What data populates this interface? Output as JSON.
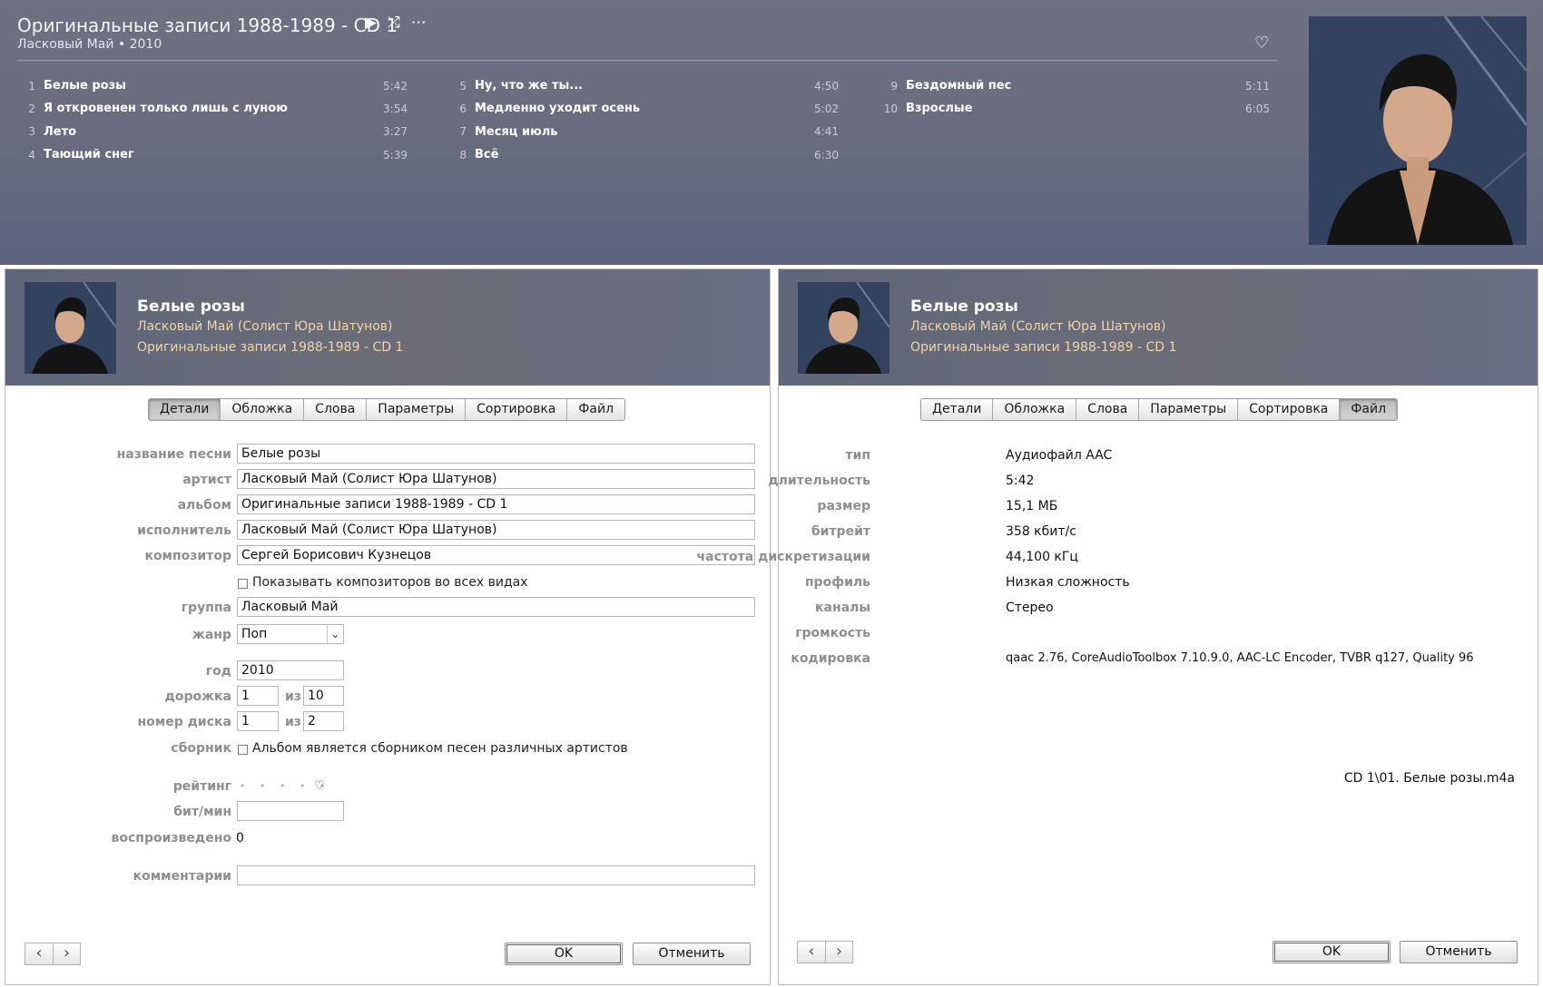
{
  "album": {
    "title": "Оригинальные записи 1988-1989 - CD 1",
    "subtitle": "Ласковый Май • 2010",
    "controls": {
      "play": "▶",
      "shuffle": "⤮",
      "more": "⋯"
    },
    "heart": "♡",
    "columns": [
      [
        {
          "num": "1",
          "name": "Белые розы",
          "dur": "5:42"
        },
        {
          "num": "2",
          "name": "Я откровенен только лишь с луною",
          "dur": "3:54"
        },
        {
          "num": "3",
          "name": "Лето",
          "dur": "3:27"
        },
        {
          "num": "4",
          "name": "Тающий снег",
          "dur": "5:39"
        }
      ],
      [
        {
          "num": "5",
          "name": "Ну, что же ты...",
          "dur": "4:50"
        },
        {
          "num": "6",
          "name": "Медленно уходит осень",
          "dur": "5:02"
        },
        {
          "num": "7",
          "name": "Месяц июль",
          "dur": "4:41"
        },
        {
          "num": "8",
          "name": "Всё",
          "dur": "6:30"
        }
      ],
      [
        {
          "num": "9",
          "name": "Бездомный пес",
          "dur": "5:11"
        },
        {
          "num": "10",
          "name": "Взрослые",
          "dur": "6:05"
        }
      ]
    ]
  },
  "song": {
    "title": "Белые розы",
    "artist": "Ласковый Май (Солист Юра Шатунов)",
    "album": "Оригинальные записи 1988-1989 - CD 1"
  },
  "tabs": [
    "Детали",
    "Обложка",
    "Слова",
    "Параметры",
    "Сортировка",
    "Файл"
  ],
  "details": {
    "labels": {
      "name": "название песни",
      "artist": "артист",
      "album": "альбом",
      "album_artist": "исполнитель",
      "composer": "композитор",
      "grouping": "группа",
      "genre": "жанр",
      "year": "год",
      "track": "дорожка",
      "disc": "номер диска",
      "compilation": "сборник",
      "rating": "рейтинг",
      "bpm": "бит/мин",
      "plays": "воспроизведено",
      "comments": "комментарии",
      "of": "из"
    },
    "values": {
      "name": "Белые розы",
      "artist": "Ласковый Май (Солист Юра Шатунов)",
      "album": "Оригинальные записи 1988-1989 - CD 1",
      "album_artist": "Ласковый Май (Солист Юра Шатунов)",
      "composer": "Сергей Борисович Кузнецов",
      "show_composer_label": "Показывать композиторов во всех видах",
      "grouping": "Ласковый Май",
      "genre": "Поп",
      "year": "2010",
      "track": "1",
      "track_total": "10",
      "disc": "1",
      "disc_total": "2",
      "compilation_label": "Альбом является сборником песен различных артистов",
      "rating_dots": "• • • • •",
      "rating_heart": "♡",
      "bpm": "",
      "plays": "0",
      "comments": ""
    }
  },
  "file": {
    "labels": {
      "kind": "тип",
      "duration": "длительность",
      "size": "размер",
      "bitrate": "битрейт",
      "sample_rate": "частота дискретизации",
      "profile": "профиль",
      "channels": "каналы",
      "volume": "громкость",
      "encoder": "кодировка"
    },
    "values": {
      "kind": "Аудиофайл AAC",
      "duration": "5:42",
      "size": "15,1 МБ",
      "bitrate": "358 кбит/с",
      "sample_rate": "44,100 кГц",
      "profile": "Низкая сложность",
      "channels": "Стерео",
      "volume": "",
      "encoder": "qaac 2.76, CoreAudioToolbox 7.10.9.0, AAC-LC Encoder, TVBR q127, Quality 96"
    },
    "path": "CD 1\\01. Белые розы.m4a"
  },
  "buttons": {
    "prev": "‹",
    "next": "›",
    "ok": "OK",
    "cancel": "Отменить"
  },
  "colors": {
    "header_bg": "#6a6d7e",
    "artist_text": "#f0d4a8",
    "label_text": "#8e8e8e"
  }
}
